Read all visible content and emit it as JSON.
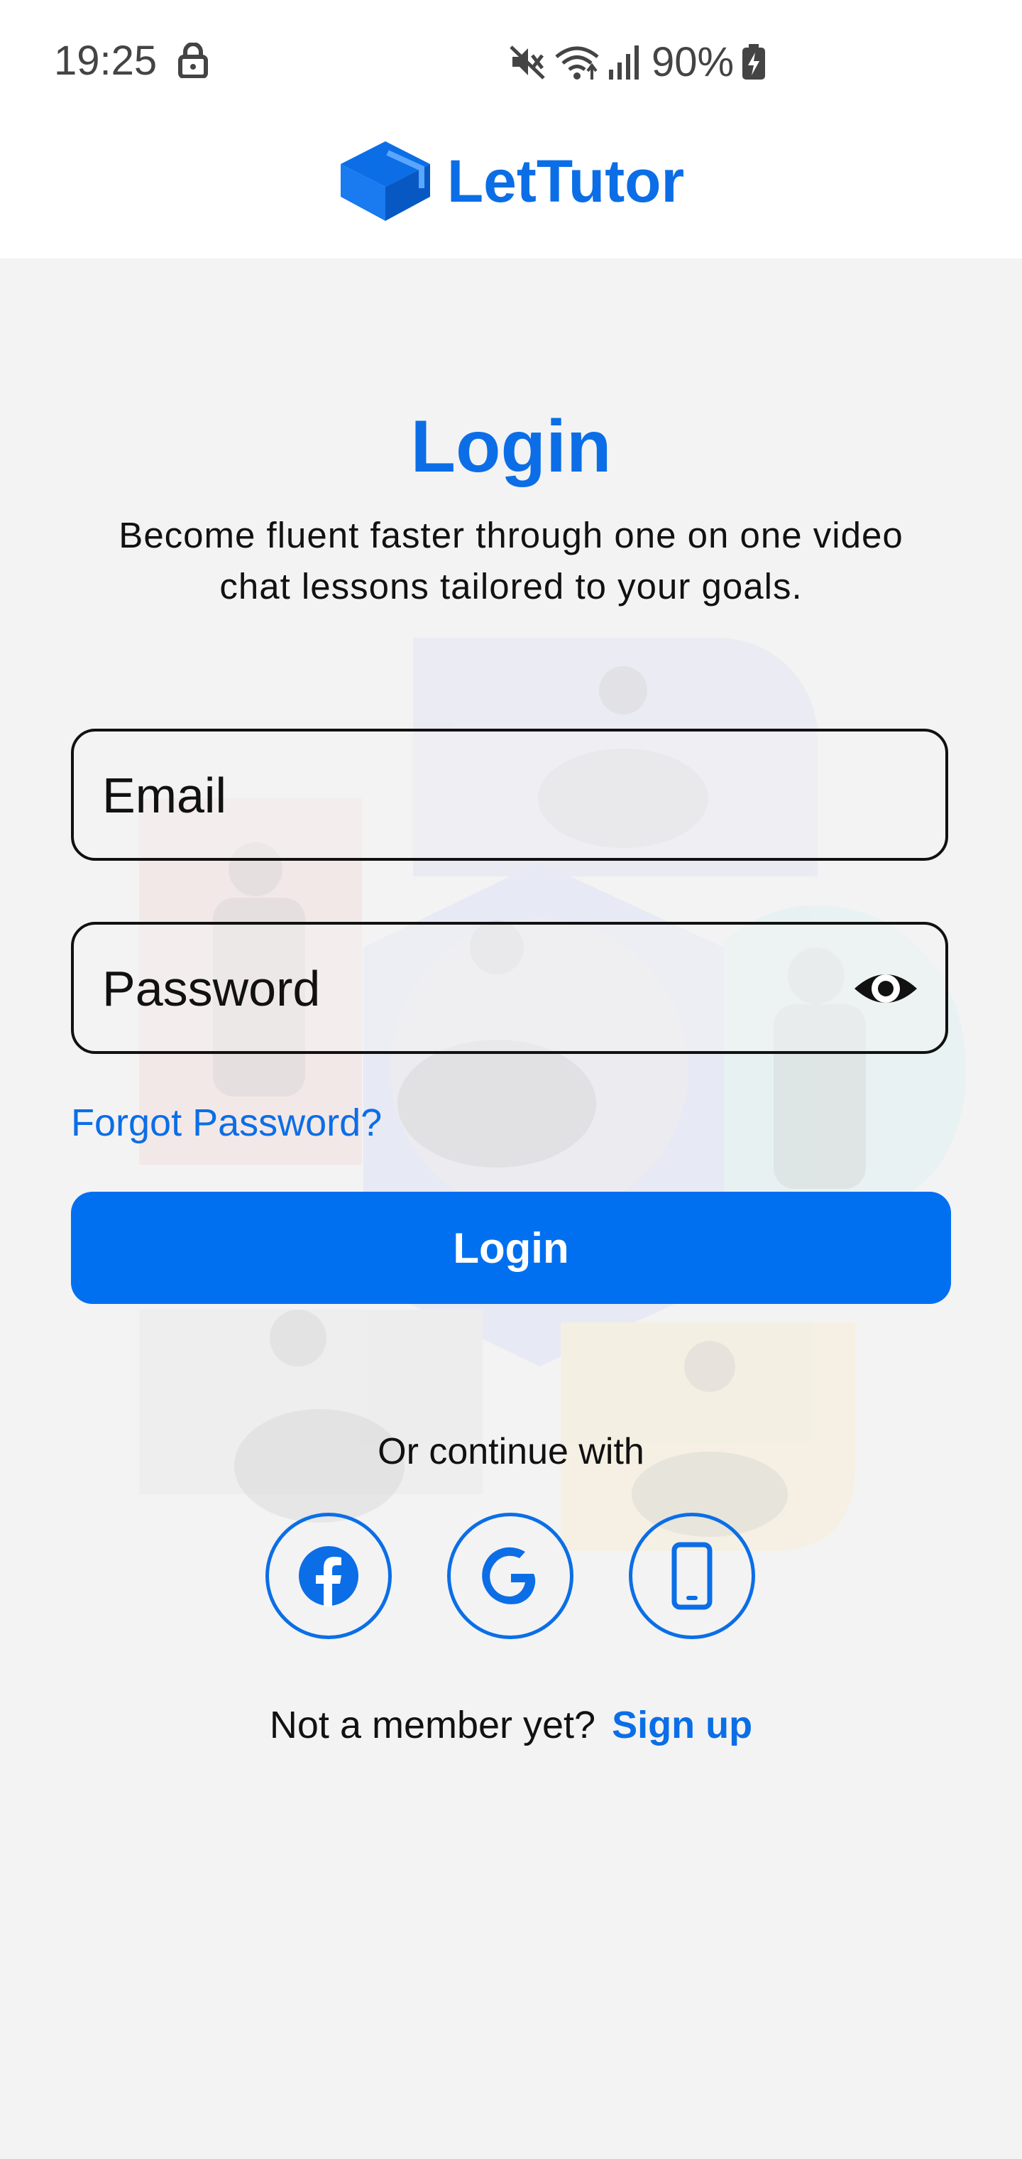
{
  "status_bar": {
    "time": "19:25",
    "battery": "90%",
    "icons": [
      "lock-icon",
      "mute-icon",
      "wifi-icon",
      "signal-icon",
      "battery-icon"
    ]
  },
  "brand": {
    "name": "LetTutor",
    "logo_icon": "graduation-cap-icon",
    "color": "#0b6ee6"
  },
  "login": {
    "title": "Login",
    "subtitle_line1": "Become fluent faster through one on one video",
    "subtitle_line2": "chat lessons tailored to your goals.",
    "email_placeholder": "Email",
    "password_placeholder": "Password",
    "password_visibility_icon": "eye-icon",
    "forgot_password": "Forgot Password?",
    "submit_label": "Login",
    "or_continue": "Or continue with",
    "social": [
      {
        "icon": "facebook-icon"
      },
      {
        "icon": "google-icon"
      },
      {
        "icon": "phone-icon"
      }
    ],
    "signup_prompt": "Not a member yet?",
    "signup_link": "Sign up"
  },
  "colors": {
    "accent": "#0b6ee6",
    "button": "#0070f0",
    "background": "#f3f3f3"
  }
}
